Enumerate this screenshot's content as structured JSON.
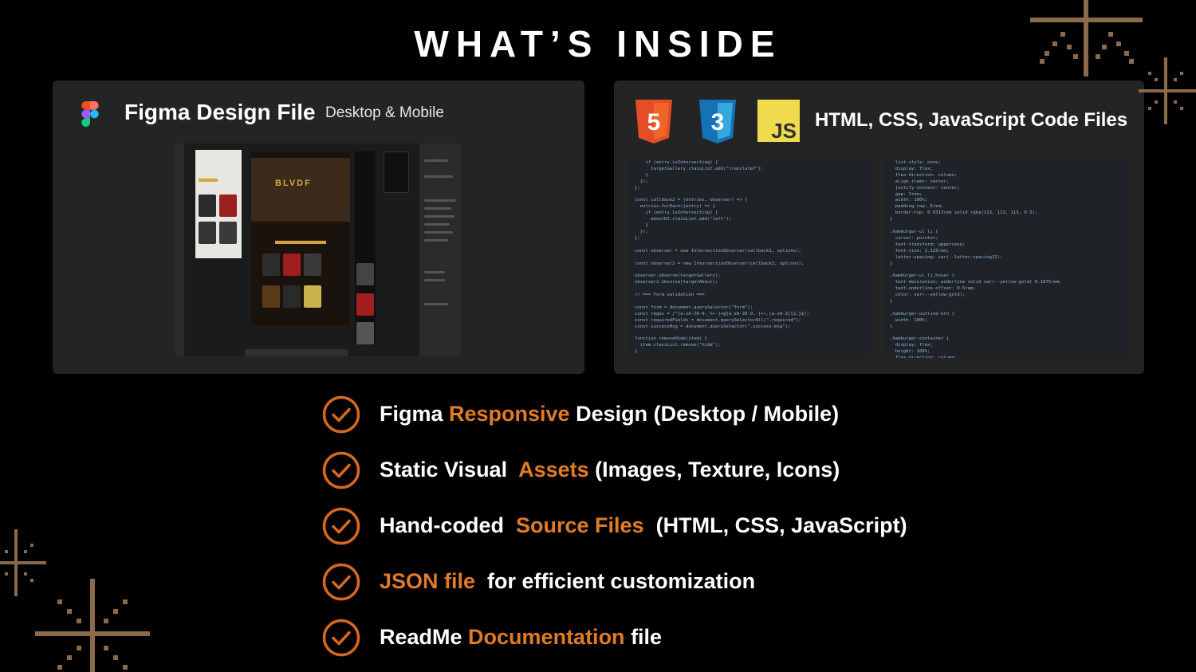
{
  "title": "WHAT’S INSIDE",
  "figma_card": {
    "title": "Figma Design File",
    "subtitle": "Desktop & Mobile",
    "logo_icon": "figma-logo-icon",
    "mock_hero_text": "BLVDF"
  },
  "code_card": {
    "title": "HTML, CSS, JavaScript Code Files",
    "icons": [
      "html5-icon",
      "css3-icon",
      "javascript-icon"
    ],
    "js_label": "JS",
    "html_label": "5",
    "css_label": "3",
    "code_left": "    if (entry.isIntersecting) {\n      targetGallery.classList.add(\"translateY\");\n    }\n  });\n};\n\nconst callback2 = (entries, observer) => {\n  entries.forEach((entry) => {\n    if (entry.isIntersecting) {\n      aboutH2.classList.add(\"left\");\n    }\n  });\n};\n\nconst observer = new IntersectionObserver(callback1, options);\n\nconst observer2 = new IntersectionObserver(callback2, options);\n\nobserver.observe(targetGallery);\nobserver2.observe(targetAbout);\n\n// === Form validation ===\n\nconst form = document.querySelector(\"form\");\nconst regex = /^[a-zA-Z0-9._%+-]+@[a-zA-Z0-9.-]+\\.[a-zA-Z]{2,}$/;\nconst requiredFields = document.querySelectorAll(\".required\");\nconst successMsg = document.querySelector(\".success-msg\");\n\nfunction removeHide(item) {\n  item.classList.remove(\"hide\");\n}",
    "code_right": "  list-style: none;\n  display: flex;\n  flex-direction: column;\n  align-items: center;\n  justify-content: center;\n  gap: 3rem;\n  width: 100%;\n  padding-top: 5rem;\n  border-top: 0.0313rem solid rgba(113, 113, 113, 0.3);\n}\n\n.hamburger-ul li {\n  cursor: pointer;\n  text-transform: uppercase;\n  font-size: 1.125rem;\n  letter-spacing: var(--letter-spacing12);\n}\n\n.hamburger-ul li:hover {\n  text-decoration: underline solid var(--yellow-gold) 0.1875rem;\n  text-underline-offset: 0.5rem;\n  color: var(--yellow-gold);\n}\n\n.hamburger-outline-btn {\n  width: 100%;\n}\n\n.hamburger-container {\n  display: flex;\n  height: 100%;\n  flex-direction: column;\n  align-items: center;\n  justify-content: space-between;"
  },
  "features": [
    {
      "parts": [
        {
          "text": "Figma ",
          "hl": false
        },
        {
          "text": "Responsive",
          "hl": true
        },
        {
          "text": " Design (Desktop / Mobile)",
          "hl": false
        }
      ]
    },
    {
      "parts": [
        {
          "text": "Static Visual  ",
          "hl": false
        },
        {
          "text": "Assets",
          "hl": true
        },
        {
          "text": " (Images, Texture, Icons)",
          "hl": false
        }
      ]
    },
    {
      "parts": [
        {
          "text": "Hand-coded  ",
          "hl": false
        },
        {
          "text": "Source Files",
          "hl": true
        },
        {
          "text": "  (HTML, CSS, JavaScript)",
          "hl": false
        }
      ]
    },
    {
      "parts": [
        {
          "text": "JSON file",
          "hl": true
        },
        {
          "text": "  for efficient customization",
          "hl": false
        }
      ]
    },
    {
      "parts": [
        {
          "text": "ReadMe ",
          "hl": false
        },
        {
          "text": "Documentation",
          "hl": true
        },
        {
          "text": " file",
          "hl": false
        }
      ]
    }
  ],
  "colors": {
    "background": "#000000",
    "card": "#242424",
    "accent": "#e07b27",
    "check": "#d4691f",
    "sparkle": "#8a6a48"
  }
}
